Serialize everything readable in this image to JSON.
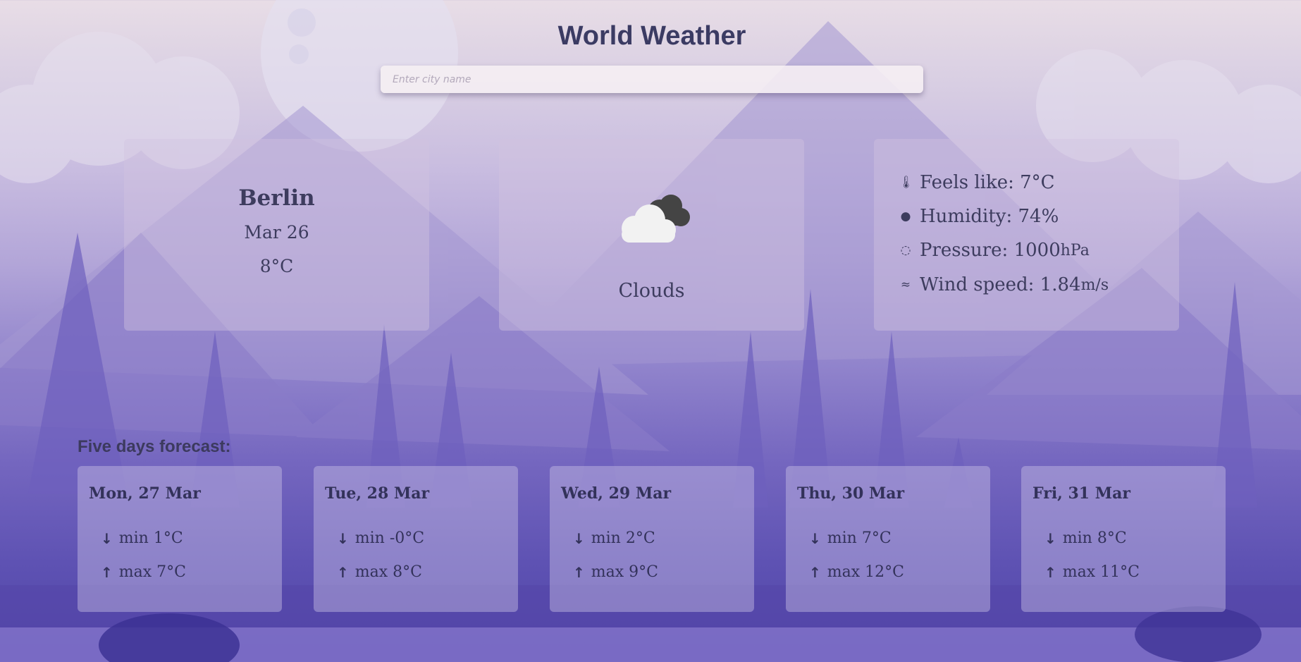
{
  "app": {
    "title": "World Weather"
  },
  "search": {
    "placeholder": "Enter city name",
    "value": ""
  },
  "current": {
    "city": "Berlin",
    "date": "Mar 26",
    "temperature": "8°C",
    "condition": "Clouds",
    "condition_icon": "cloud-icon"
  },
  "details": [
    {
      "icon": "thermometer-icon",
      "label": "Feels like: 7°C",
      "unit": ""
    },
    {
      "icon": "droplet-icon",
      "label": "Humidity: 74%",
      "unit": ""
    },
    {
      "icon": "pressure-icon",
      "label": "Pressure: 1000",
      "unit": "hPa"
    },
    {
      "icon": "wind-icon",
      "label": "Wind speed: 1.84",
      "unit": "m/s"
    }
  ],
  "forecast": {
    "title": "Five days forecast:",
    "days": [
      {
        "day": "Mon, 27 Mar",
        "min": "min 1°C",
        "max": "max 7°C"
      },
      {
        "day": "Tue, 28 Mar",
        "min": "min -0°C",
        "max": "max 8°C"
      },
      {
        "day": "Wed, 29 Mar",
        "min": "min 2°C",
        "max": "max 9°C"
      },
      {
        "day": "Thu, 30 Mar",
        "min": "min 7°C",
        "max": "max 12°C"
      },
      {
        "day": "Fri, 31 Mar",
        "min": "min 8°C",
        "max": "max 11°C"
      }
    ],
    "arrow_down": "↓",
    "arrow_up": "↑"
  },
  "colors": {
    "text": "#3d3c5e",
    "cloud_dark": "#444444",
    "cloud_light": "#f2f2f2"
  }
}
